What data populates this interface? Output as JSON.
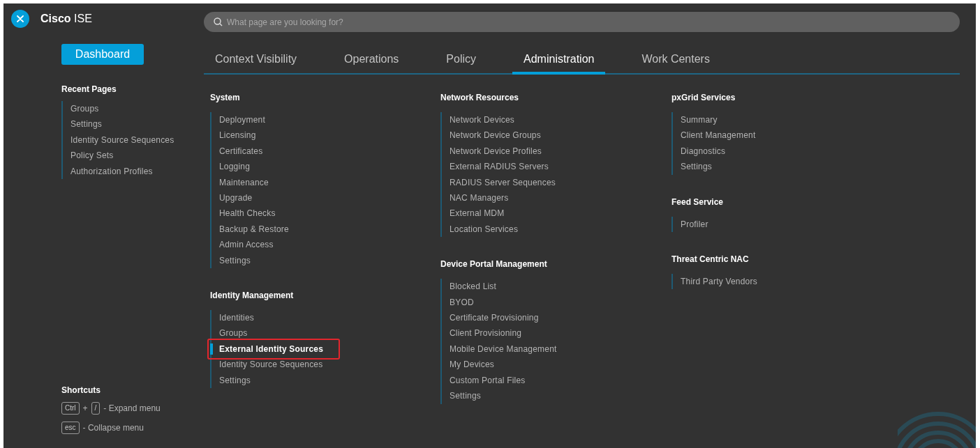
{
  "header": {
    "title": "**Cisco** ISE",
    "search": {
      "placeholder": "What page are you looking for?"
    }
  },
  "sidebar": {
    "dashboard": "Dashboard",
    "recent_title": "Recent Pages",
    "recent": [
      "Groups",
      "Settings",
      "Identity Source Sequences",
      "Policy Sets",
      "Authorization Profiles"
    ],
    "shortcuts_title": "Shortcuts",
    "shortcuts": [
      {
        "keys": [
          "Ctrl",
          "/"
        ],
        "separator": "+",
        "action": "- Expand menu"
      },
      {
        "keys": [
          "esc"
        ],
        "action": "- Collapse menu"
      }
    ]
  },
  "tabs": [
    {
      "label": "Context Visibility",
      "selected": false
    },
    {
      "label": "Operations",
      "selected": false
    },
    {
      "label": "Policy",
      "selected": false
    },
    {
      "label": "Administration",
      "selected": true
    },
    {
      "label": "Work Centers",
      "selected": false
    }
  ],
  "columns": [
    {
      "sections": [
        {
          "title": "System",
          "items": [
            {
              "label": "Deployment",
              "selected": false
            },
            {
              "label": "Licensing",
              "selected": false
            },
            {
              "label": "Certificates",
              "selected": false
            },
            {
              "label": "Logging",
              "selected": false
            },
            {
              "label": "Maintenance",
              "selected": false
            },
            {
              "label": "Upgrade",
              "selected": false
            },
            {
              "label": "Health Checks",
              "selected": false
            },
            {
              "label": "Backup & Restore",
              "selected": false
            },
            {
              "label": "Admin Access",
              "selected": false
            },
            {
              "label": "Settings",
              "selected": false
            }
          ]
        },
        {
          "title": "Identity Management",
          "items": [
            {
              "label": "Identities",
              "selected": false
            },
            {
              "label": "Groups",
              "selected": false
            },
            {
              "label": "External Identity Sources",
              "selected": true
            },
            {
              "label": "Identity Source Sequences",
              "selected": false
            },
            {
              "label": "Settings",
              "selected": false
            }
          ]
        }
      ]
    },
    {
      "sections": [
        {
          "title": "Network Resources",
          "items": [
            {
              "label": "Network Devices",
              "selected": false
            },
            {
              "label": "Network Device Groups",
              "selected": false
            },
            {
              "label": "Network Device Profiles",
              "selected": false
            },
            {
              "label": "External RADIUS Servers",
              "selected": false
            },
            {
              "label": "RADIUS Server Sequences",
              "selected": false
            },
            {
              "label": "NAC Managers",
              "selected": false
            },
            {
              "label": "External MDM",
              "selected": false
            },
            {
              "label": "Location Services",
              "selected": false
            }
          ]
        },
        {
          "title": "Device Portal Management",
          "items": [
            {
              "label": "Blocked List",
              "selected": false
            },
            {
              "label": "BYOD",
              "selected": false
            },
            {
              "label": "Certificate Provisioning",
              "selected": false
            },
            {
              "label": "Client Provisioning",
              "selected": false
            },
            {
              "label": "Mobile Device Management",
              "selected": false
            },
            {
              "label": "My Devices",
              "selected": false
            },
            {
              "label": "Custom Portal Files",
              "selected": false
            },
            {
              "label": "Settings",
              "selected": false
            }
          ]
        }
      ]
    },
    {
      "sections": [
        {
          "title": "pxGrid Services",
          "items": [
            {
              "label": "Summary",
              "selected": false
            },
            {
              "label": "Client Management",
              "selected": false
            },
            {
              "label": "Diagnostics",
              "selected": false
            },
            {
              "label": "Settings",
              "selected": false
            }
          ]
        },
        {
          "title": "Feed Service",
          "items": [
            {
              "label": "Profiler",
              "selected": false
            }
          ]
        },
        {
          "title": "Threat Centric NAC",
          "items": [
            {
              "label": "Third Party Vendors",
              "selected": false
            }
          ]
        }
      ]
    }
  ]
}
